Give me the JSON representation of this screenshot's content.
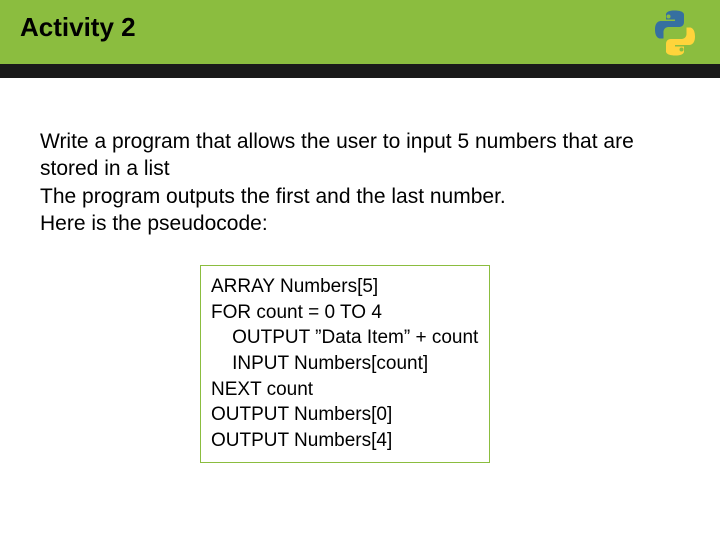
{
  "header": {
    "title": "Activity 2",
    "logo_name": "python-logo"
  },
  "body": {
    "line1": "Write a program that allows the user to input 5 numbers that are stored in a list",
    "line2": "The program outputs the first and the last number.",
    "line3": "Here is the pseudocode:"
  },
  "code": {
    "text": "ARRAY Numbers[5]\nFOR count = 0 TO 4\n    OUTPUT ”Data Item” + count\n    INPUT Numbers[count]\nNEXT count\nOUTPUT Numbers[0]\nOUTPUT Numbers[4]"
  }
}
